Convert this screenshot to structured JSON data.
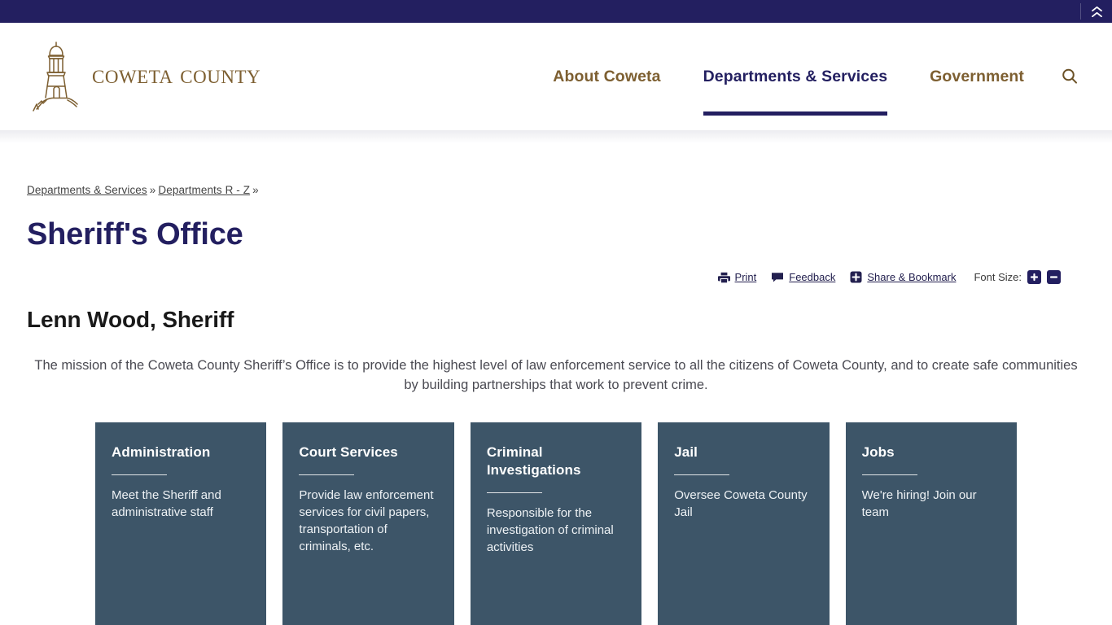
{
  "topbar": {
    "collapse_icon": "double-chevron-up-icon"
  },
  "header": {
    "logo_text": "Coweta County",
    "logo_icon": "lighthouse-icon",
    "search_icon": "search-icon",
    "nav": [
      {
        "label": "About Coweta",
        "active": false
      },
      {
        "label": "Departments & Services",
        "active": true
      },
      {
        "label": "Government",
        "active": false
      }
    ]
  },
  "breadcrumb": {
    "items": [
      "Departments & Services",
      "Departments R - Z"
    ],
    "separator": "»",
    "trailing_separator": "»"
  },
  "page": {
    "title": "Sheriff's Office",
    "sheriff_name": "Lenn Wood, Sheriff",
    "mission": "The mission of the Coweta County Sheriff’s Office is to provide the highest level of law enforcement service to all the citizens of Coweta County, and to create safe communities by building partnerships that work to prevent crime."
  },
  "tools": {
    "print": {
      "label": "Print",
      "icon": "printer-icon"
    },
    "feedback": {
      "label": "Feedback",
      "icon": "speech-bubble-icon"
    },
    "share": {
      "label": "Share & Bookmark",
      "icon": "plus-square-icon"
    },
    "font_size_label": "Font Size:",
    "font_increase": {
      "glyph": "+",
      "icon": "plus-icon"
    },
    "font_decrease": {
      "glyph": "−",
      "icon": "minus-icon"
    }
  },
  "cards": [
    {
      "title": "Administration",
      "desc": "Meet the Sheriff and administrative staff"
    },
    {
      "title": "Court Services",
      "desc": "Provide law enforcement services for civil papers, transportation of criminals, etc."
    },
    {
      "title": "Criminal Investigations",
      "desc": "Responsible for the investigation of criminal activities"
    },
    {
      "title": "Jail",
      "desc": "Oversee Coweta County Jail"
    },
    {
      "title": "Jobs",
      "desc": "We're hiring! Join our team"
    }
  ],
  "colors": {
    "navy": "#231f60",
    "gold": "#7d5f31",
    "card_bg": "#3d5568",
    "body_text": "#4a4a52"
  }
}
